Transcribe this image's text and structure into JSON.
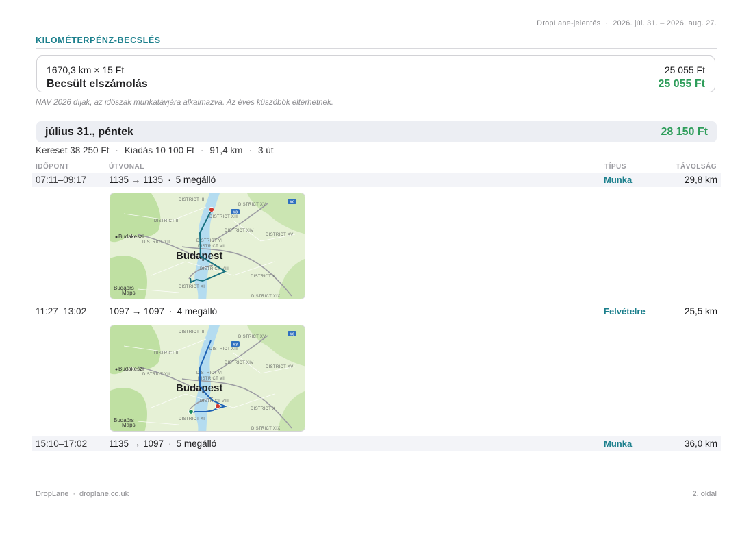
{
  "header": {
    "report_name": "DropLane-jelentés",
    "period": "2026. júl. 31. – 2026. aug. 27."
  },
  "section": {
    "title": "KILOMÉTERPÉNZ-BECSLÉS"
  },
  "estimate": {
    "formula": "1670,3 km × 15 Ft",
    "formula_value": "25 055 Ft",
    "label": "Becsült elszámolás",
    "total": "25 055 Ft",
    "note": "NAV 2026 díjak, az időszak munkatávjára alkalmazva. Az éves küszöbök eltérhetnek."
  },
  "day": {
    "title": "július 31., péntek",
    "total": "28 150 Ft",
    "stats": [
      "Kereset 38 250 Ft",
      "Kiadás 10 100 Ft",
      "91,4 km",
      "3 út"
    ]
  },
  "columns": {
    "time": "IDŐPONT",
    "route": "ÚTVONAL",
    "type": "TÍPUS",
    "distance": "TÁVOLSÁG"
  },
  "trips": [
    {
      "time": "07:11–09:17",
      "route": "1135 → 1135",
      "stops": "5 megálló",
      "type": "Munka",
      "distance": "29,8 km"
    },
    {
      "time": "11:27–13:02",
      "route": "1097 → 1097",
      "stops": "4 megálló",
      "type": "Felvételre",
      "distance": "25,5 km"
    },
    {
      "time": "15:10–17:02",
      "route": "1135 → 1097",
      "stops": "5 megálló",
      "type": "Munka",
      "distance": "36,0 km"
    }
  ],
  "map": {
    "city": "Budapest",
    "labels": {
      "d3": "DISTRICT III",
      "d15": "DISTRICT XV",
      "d2": "DISTRICT II",
      "d13": "DISTRICT XIII",
      "d14": "DISTRICT XIV",
      "d16": "DISTRICT XVI",
      "d12": "DISTRICT XII",
      "d6": "DISTRICT VI",
      "d7": "DISTRICT VII",
      "d8": "DISTRICT VIII",
      "d10": "DISTRICT X",
      "d11": "DISTRICT XI",
      "d19": "DISTRICT XIX",
      "budakeszi": "Budakeszi",
      "budaors": "Budaörs",
      "m0": "M0",
      "m3": "M3",
      "attribution": "Maps"
    },
    "colors": {
      "land": "#e6f1d6",
      "green": "#bfe0a2",
      "river": "#b4dcf0",
      "route_work": "#16707e",
      "route_pickup": "#1e63b5"
    }
  },
  "footer": {
    "brand": "DropLane",
    "site": "droplane.co.uk",
    "page": "2. oldal"
  }
}
